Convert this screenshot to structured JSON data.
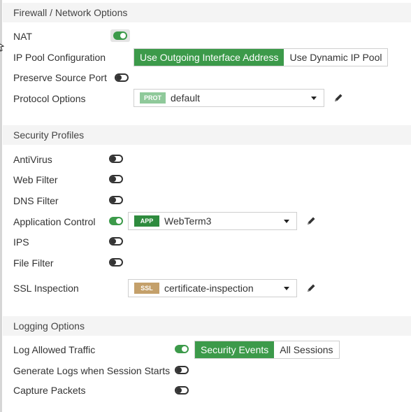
{
  "firewall": {
    "header": "Firewall / Network Options",
    "nat_label": "NAT",
    "nat_on": true,
    "ip_pool_label": "IP Pool Configuration",
    "ip_pool_options": [
      "Use Outgoing Interface Address",
      "Use Dynamic IP Pool"
    ],
    "ip_pool_selected": "Use Outgoing Interface Address",
    "preserve_label": "Preserve Source Port",
    "preserve_on": false,
    "protocol_label": "Protocol Options",
    "protocol_badge": "PROT",
    "protocol_value": "default"
  },
  "security": {
    "header": "Security Profiles",
    "antivirus_label": "AntiVirus",
    "webfilter_label": "Web Filter",
    "dnsfilter_label": "DNS Filter",
    "appcontrol_label": "Application Control",
    "appcontrol_badge": "APP",
    "appcontrol_value": "WebTerm3",
    "ips_label": "IPS",
    "filefilter_label": "File Filter",
    "ssl_label": "SSL Inspection",
    "ssl_badge": "SSL",
    "ssl_value": "certificate-inspection"
  },
  "logging": {
    "header": "Logging Options",
    "log_allowed_label": "Log Allowed Traffic",
    "log_allowed_on": true,
    "log_options": [
      "Security Events",
      "All Sessions"
    ],
    "log_selected": "Security Events",
    "gen_logs_label": "Generate Logs when Session Starts",
    "capture_label": "Capture Packets"
  },
  "colors": {
    "accent_green": "#3c9a4a",
    "prot_badge": "#8fc99a",
    "app_badge": "#2e8b3e",
    "ssl_badge": "#c4a06a"
  },
  "icons": {
    "edit": "pencil-icon",
    "caret": "chevron-down-icon",
    "cursor": "mouse-cursor-icon"
  }
}
